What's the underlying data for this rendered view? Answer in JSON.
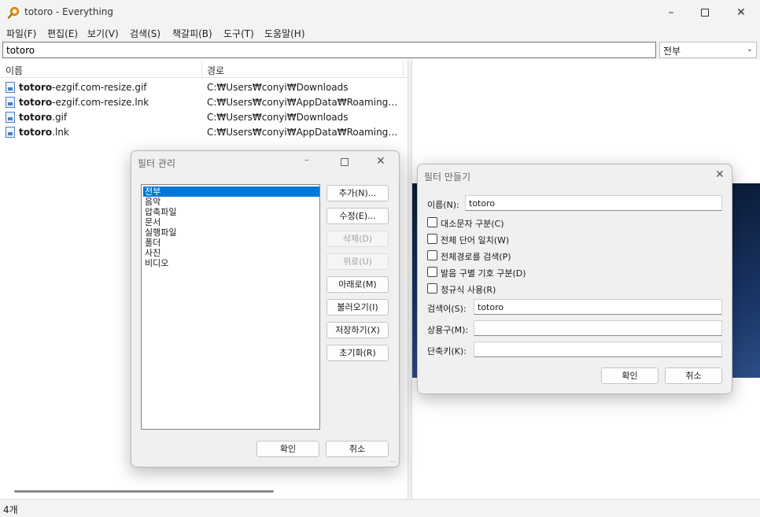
{
  "window": {
    "title": "totoro - Everything"
  },
  "menu": [
    "파일(F)",
    "편집(E)",
    "보기(V)",
    "검색(S)",
    "책갈피(B)",
    "도구(T)",
    "도움말(H)"
  ],
  "search": {
    "value": "totoro",
    "filter": "전부"
  },
  "columns": {
    "name": "이름",
    "path": "경로"
  },
  "results": [
    {
      "bold": "totoro",
      "rest": "-ezgif.com-resize.gif",
      "path": "C:₩Users₩conyi₩Downloads"
    },
    {
      "bold": "totoro",
      "rest": "-ezgif.com-resize.lnk",
      "path": "C:₩Users₩conyi₩AppData₩Roaming₩Micro..."
    },
    {
      "bold": "totoro",
      "rest": ".gif",
      "path": "C:₩Users₩conyi₩Downloads"
    },
    {
      "bold": "totoro",
      "rest": ".lnk",
      "path": "C:₩Users₩conyi₩AppData₩Roaming₩Micro..."
    }
  ],
  "status": {
    "count": "4개"
  },
  "filter_manager": {
    "title": "필터 관리",
    "items": [
      "전부",
      "음악",
      "압축파일",
      "문서",
      "실행파일",
      "폴더",
      "사진",
      "비디오"
    ],
    "selected_index": 0,
    "buttons": {
      "add": "추가(N)...",
      "edit": "수정(E)...",
      "delete": "삭제(D)",
      "up": "위로(U)",
      "down": "아래로(M)",
      "import": "불러오기(I)",
      "export": "저장하기(X)",
      "reset": "초기화(R)",
      "ok": "확인",
      "cancel": "취소"
    }
  },
  "filter_builder": {
    "title": "필터 만들기",
    "name_label": "이름(N):",
    "name_value": "totoro",
    "options": [
      {
        "label": "대소문자 구분(C)",
        "checked": false
      },
      {
        "label": "전체 단어 일치(W)",
        "checked": false
      },
      {
        "label": "전체경로를 검색(P)",
        "checked": false
      },
      {
        "label": "발음 구별 기호 구분(D)",
        "checked": false
      },
      {
        "label": "정규식 사용(R)",
        "checked": false
      }
    ],
    "search_label": "검색어(S):",
    "search_value": "totoro",
    "macro_label": "상용구(M):",
    "macro_value": "",
    "shortcut_label": "단축키(K):",
    "shortcut_value": "",
    "ok": "확인",
    "cancel": "취소"
  }
}
